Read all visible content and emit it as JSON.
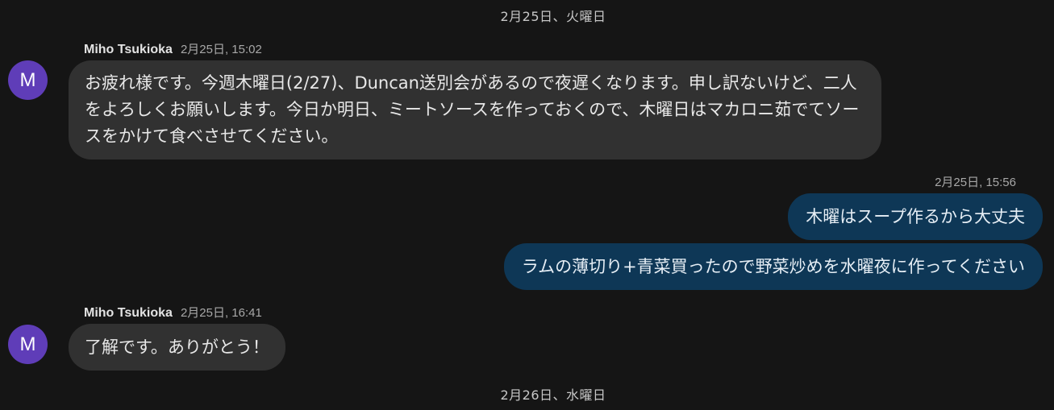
{
  "date_dividers": [
    "2月25日、火曜日",
    "2月26日、水曜日"
  ],
  "messages": [
    {
      "sender": "Miho Tsukioka",
      "avatar_letter": "M",
      "time": "2月25日, 15:02",
      "text": "お疲れ様です。今週木曜日(2/27)、Duncan送別会があるので夜遅くなります。申し訳ないけど、二人をよろしくお願いします。今日か明日、ミートソースを作っておくので、木曜日はマカロニ茹でてソースをかけて食べさせてください。"
    },
    {
      "sender": "self",
      "time": "2月25日, 15:56",
      "texts": [
        "木曜はスープ作るから大丈夫",
        "ラムの薄切り+青菜買ったので野菜炒めを水曜夜に作ってください"
      ]
    },
    {
      "sender": "Miho Tsukioka",
      "avatar_letter": "M",
      "time": "2月25日, 16:41",
      "text": "了解です。ありがとう！"
    }
  ],
  "colors": {
    "background": "#151515",
    "incoming_bubble": "#313131",
    "outgoing_bubble": "#0e3756",
    "avatar": "#5f3db8"
  }
}
